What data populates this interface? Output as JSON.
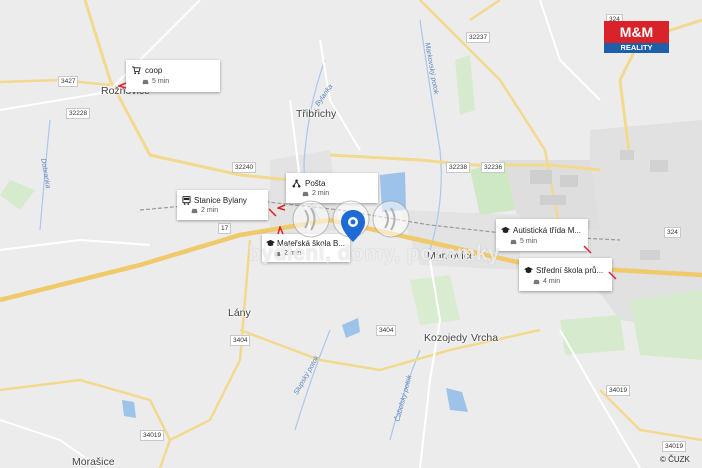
{
  "brand": {
    "logo_top": "M&M",
    "logo_bottom": "REALITY"
  },
  "watermark": "bydlení, domy, pozemky",
  "copyright": "© ČUZK",
  "colors": {
    "brand_red": "#d9232b",
    "brand_blue": "#1d5fa8",
    "pin": "#1e6bd6",
    "highway": "#f5d37a",
    "water": "#9ec3ea",
    "green": "#cfe8c4"
  },
  "places": {
    "roznovice": "Rožnovice",
    "tribrichy": "Třibřichy",
    "markovice": "Markovice",
    "lany": "Lány",
    "kozojedy": "Kozojedy",
    "vrcha": "Vrcha",
    "morasice": "Morašice"
  },
  "road_numbers": {
    "r324a": "324",
    "r32237": "32237",
    "r3427": "3427",
    "r32228": "32228",
    "r32240": "32240",
    "r32238": "32238",
    "r32236": "32236",
    "r17": "17",
    "r324b": "324",
    "r3404a": "3404",
    "r3404b": "3404",
    "r34019a": "34019",
    "r34019b": "34019",
    "r34019c": "34019"
  },
  "waterways": {
    "bylanka": "Bylanka",
    "markovsky": "Markovský potok",
    "dobranka": "Dobranka",
    "slupsky": "Slupský potok",
    "cabelsky": "Čabelský potok"
  },
  "pois": [
    {
      "icon": "cart-icon",
      "title": "coop",
      "time": "5 min"
    },
    {
      "icon": "bus-icon",
      "title": "Stanice Bylany",
      "time": "2 min"
    },
    {
      "icon": "post-icon",
      "title": "Pošta",
      "time": "2 min"
    },
    {
      "icon": "school-icon",
      "title": "Mateřská škola B...",
      "time": "2 min"
    },
    {
      "icon": "school-icon",
      "title": "Autistická třída M...",
      "time": "5 min"
    },
    {
      "icon": "school-icon",
      "title": "Střední škola prů...",
      "time": "4 min"
    }
  ],
  "icons": {
    "car": "car-icon",
    "pin": "location-pin-icon"
  }
}
